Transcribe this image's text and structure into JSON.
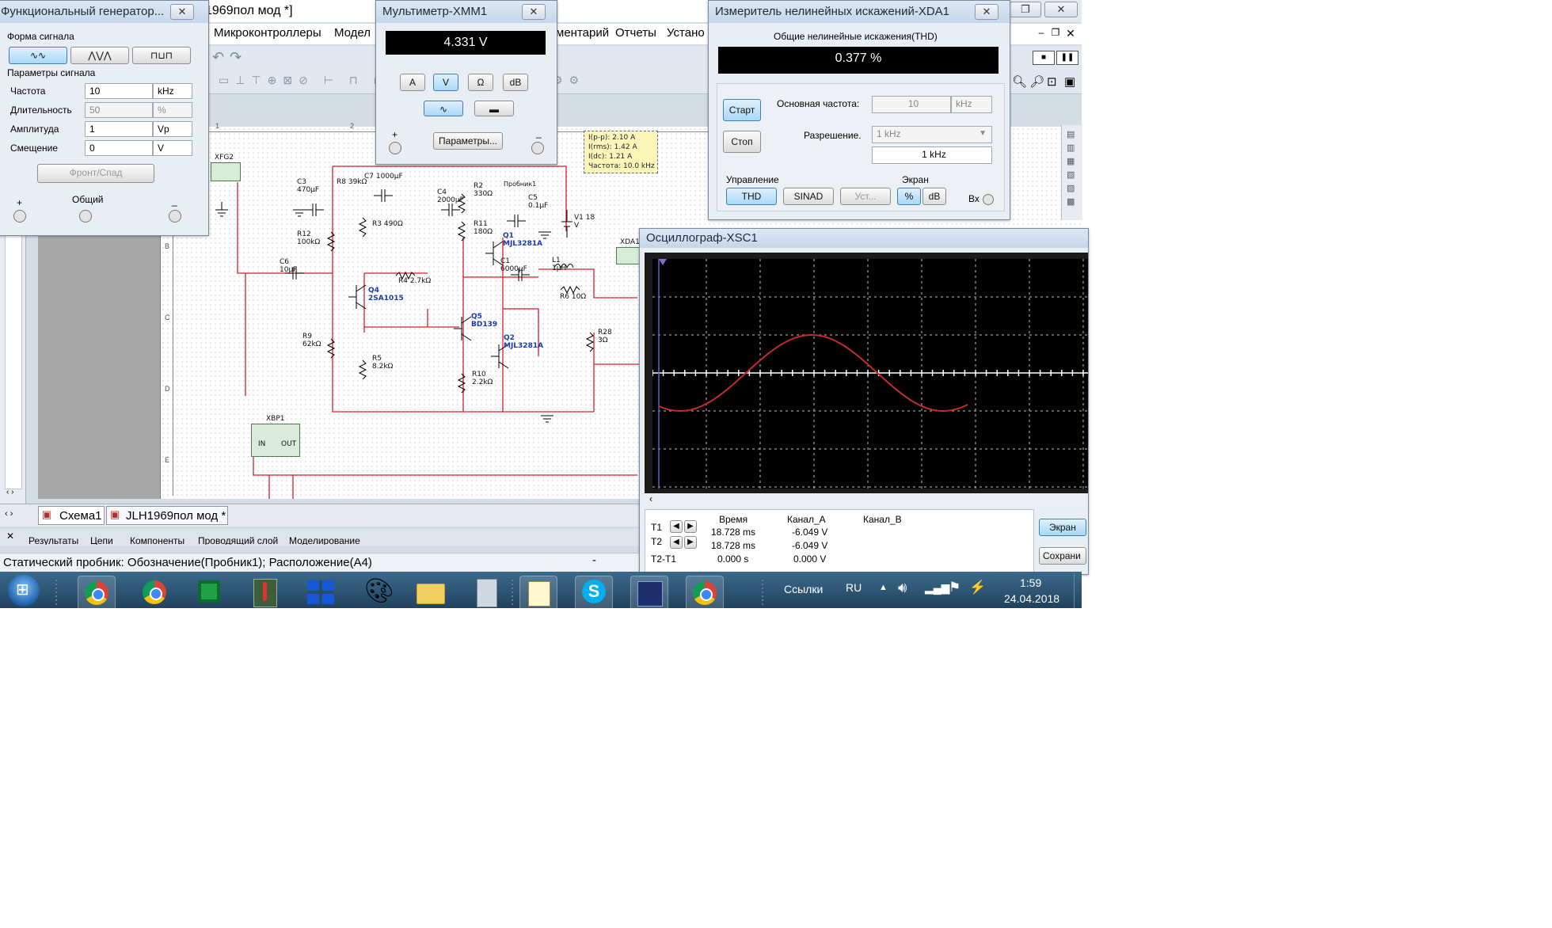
{
  "app": {
    "title_fragment": "1969пол мод *]",
    "menu": [
      "Микроконтроллеры",
      "Модел",
      "ментарий",
      "Отчеты",
      "Устано"
    ]
  },
  "tabs": [
    "Схема1",
    "JLH1969пол мод *"
  ],
  "bottom_tabs": [
    "Результаты",
    "Цепи",
    "Компоненты",
    "Проводящий слой",
    "Моделирование"
  ],
  "status_bar": "Статический пробник: Обозначение(Пробник1); Расположение(A4)",
  "fgen": {
    "title": "Функциональный генератор...",
    "wave_section": "Форма сигнала",
    "params_section": "Параметры сигнала",
    "rows": [
      {
        "label": "Частота",
        "value": "10",
        "unit": "kHz"
      },
      {
        "label": "Длительность",
        "value": "50",
        "unit": "%"
      },
      {
        "label": "Амплитуда",
        "value": "1",
        "unit": "Vp"
      },
      {
        "label": "Смещение",
        "value": "0",
        "unit": "V"
      }
    ],
    "rise_fall": "Фронт/Спад",
    "plus": "+",
    "common": "Общий",
    "minus": "_"
  },
  "mm": {
    "title": "Мультиметр-XMM1",
    "display": "4.331 V",
    "modes": [
      "A",
      "V",
      "Ω",
      "dB"
    ],
    "params": "Параметры...",
    "plus": "+",
    "minus": "_"
  },
  "probe": {
    "lines": [
      "I(p-p): 2.10 A",
      "I(rms): 1.42 A",
      "I(dc): 1.21 A",
      "Частота: 10.0 kHz"
    ],
    "tag": "Пробник1"
  },
  "thd": {
    "title": "Измеритель нелинейных искажений-XDA1",
    "heading": "Общие нелинейные искажения(THD)",
    "display": "0.377 %",
    "start": "Старт",
    "stop": "Стоп",
    "fund_label": "Основная частота:",
    "fund_value": "10",
    "fund_unit": "kHz",
    "res_label": "Разрешение.",
    "res_value": "1 kHz",
    "res_readout": "1 kHz",
    "control": "Управление",
    "screen": "Экран",
    "thd_btn": "THD",
    "sinad_btn": "SINAD",
    "set_btn": "Уст...",
    "pct_btn": "%",
    "db_btn": "dB",
    "in_label": "Вх"
  },
  "scope": {
    "title": "Осциллограф-XSC1",
    "headers": [
      "Время",
      "Канал_A",
      "Канал_B"
    ],
    "rows": [
      {
        "label": "T1",
        "time": "18.728 ms",
        "a": "-6.049 V",
        "b": ""
      },
      {
        "label": "T2",
        "time": "18.728 ms",
        "a": "-6.049 V",
        "b": ""
      },
      {
        "label": "T2-T1",
        "time": "0.000 s",
        "a": "0.000 V",
        "b": ""
      }
    ],
    "btn_screen": "Экран",
    "btn_save": "Сохрани"
  },
  "schematic": {
    "components": [
      "C3 470µF",
      "R8 39kΩ",
      "C7 1000µF",
      "C4 2000µF",
      "R2 330Ω",
      "C5 0.1µF",
      "V1 18 V",
      "R12 100kΩ",
      "R3 490Ω",
      "R11 180Ω",
      "Q1 MJL3281A",
      "C6 10µF",
      "R4 2.7kΩ",
      "C1 6000µF",
      "L1 1µH",
      "R6 10Ω",
      "Q4 2SA1015",
      "Q5 BD139",
      "Q2 MJL3281A",
      "R28 3Ω",
      "R9 62kΩ",
      "R5 8.2kΩ",
      "R10 2.2kΩ"
    ],
    "xfg": "XFG2",
    "xbp": "XBP1",
    "xbp_in": "IN",
    "xbp_out": "OUT",
    "xda": "XDA1",
    "ruler": [
      "1",
      "2"
    ],
    "left_letters": [
      "B",
      "C",
      "D",
      "E"
    ]
  },
  "taskbar": {
    "links": "Ссылки",
    "lang": "RU",
    "time": "1:59",
    "date": "24.04.2018"
  },
  "colors": {
    "display_bg": "#000000",
    "trace": "#c42b2b",
    "wire": "#d0212b",
    "taskbar": "#2a4a66"
  }
}
